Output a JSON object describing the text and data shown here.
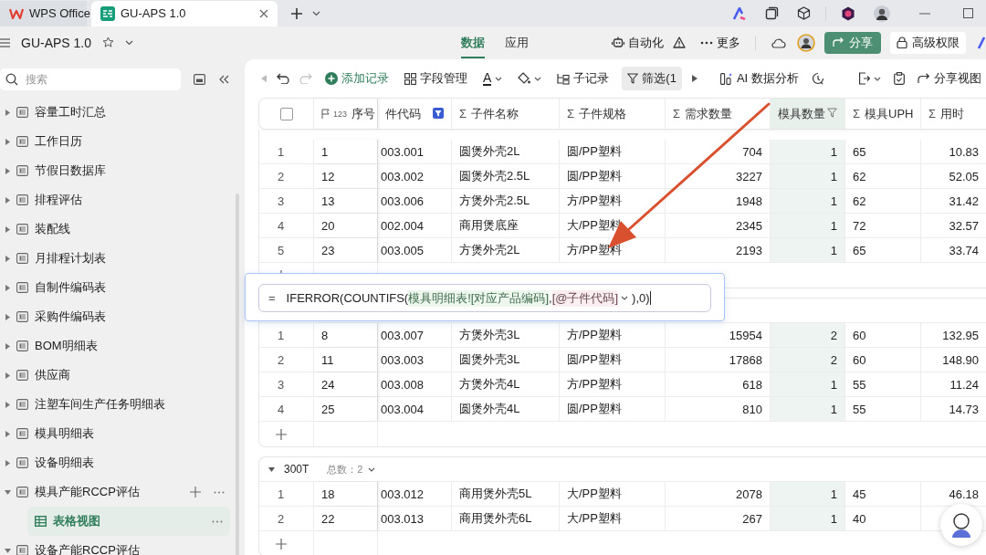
{
  "title_bar": {
    "tabs": [
      {
        "label": "WPS Office",
        "selected": false
      },
      {
        "label": "GU-APS 1.0",
        "selected": true
      }
    ]
  },
  "app_bar": {
    "title": "GU-APS 1.0",
    "tabs": [
      {
        "label": "数据",
        "selected": true
      },
      {
        "label": "应用",
        "selected": false
      }
    ],
    "automation": "自动化",
    "more": "更多",
    "share": "分享",
    "permissions": "高级权限"
  },
  "sidebar": {
    "search": {
      "placeholder": "搜索"
    },
    "items": [
      {
        "label": "容量工时汇总",
        "expanded": false,
        "hovered": false
      },
      {
        "label": "工作日历",
        "expanded": false,
        "hovered": false
      },
      {
        "label": "节假日数据库",
        "expanded": false,
        "hovered": false
      },
      {
        "label": "排程评估",
        "expanded": false,
        "hovered": false
      },
      {
        "label": "装配线",
        "expanded": false,
        "hovered": false
      },
      {
        "label": "月排程计划表",
        "expanded": false,
        "hovered": false
      },
      {
        "label": "自制件编码表",
        "expanded": false,
        "hovered": false
      },
      {
        "label": "采购件编码表",
        "expanded": false,
        "hovered": false
      },
      {
        "label": "BOM明细表",
        "expanded": false,
        "hovered": false
      },
      {
        "label": "供应商",
        "expanded": false,
        "hovered": false
      },
      {
        "label": "注塑车间生产任务明细表",
        "expanded": false,
        "hovered": false
      },
      {
        "label": "模具明细表",
        "expanded": false,
        "hovered": false
      },
      {
        "label": "设备明细表",
        "expanded": false,
        "hovered": false
      },
      {
        "label": "模具产能RCCP评估",
        "expanded": true,
        "hovered": true,
        "children": [
          {
            "label": "表格视图",
            "selected": true
          }
        ]
      },
      {
        "label": "设备产能RCCP评估",
        "expanded": true,
        "hovered": false
      }
    ]
  },
  "toolbar": {
    "redo": {
      "disabled": true
    },
    "add_record": "添加记录",
    "fields": "字段管理",
    "font_glyph": "A",
    "sub_records": "子记录",
    "filter": {
      "label": "筛选(1",
      "active": true
    },
    "ai": "AI 数据分析",
    "share_view": "分享视图"
  },
  "table": {
    "select_all": {
      "checked": false
    },
    "columns": [
      {
        "label": "序号",
        "kind": "index",
        "badge": "123",
        "filtered": false,
        "selected": false
      },
      {
        "label": "件代码",
        "kind": "text",
        "filtered": true,
        "selected": false
      },
      {
        "label": "子件名称",
        "kind": "text",
        "glyph": "Σ",
        "filtered": false,
        "selected": false
      },
      {
        "label": "子件规格",
        "kind": "text",
        "glyph": "Σ",
        "filtered": false,
        "selected": false
      },
      {
        "label": "需求数量",
        "kind": "number",
        "glyph": "Σ",
        "filtered": false,
        "selected": false
      },
      {
        "label": "模具数量",
        "kind": "number",
        "filtered": true,
        "selected": true
      },
      {
        "label": "模具UPH",
        "kind": "text",
        "glyph": "Σ",
        "filtered": false,
        "selected": false
      },
      {
        "label": "用时",
        "kind": "number",
        "glyph": "Σ",
        "filtered": false,
        "selected": false
      }
    ],
    "groups": [
      {
        "expanded": true,
        "rows": [
          {
            "no": "1",
            "cells": [
              "1",
              "003.001",
              "圆煲外壳2L",
              "圆/PP塑料",
              "704",
              "1",
              "65",
              "10.83"
            ]
          },
          {
            "no": "2",
            "cells": [
              "12",
              "003.002",
              "圆煲外壳2.5L",
              "圆/PP塑料",
              "3227",
              "1",
              "62",
              "52.05"
            ]
          },
          {
            "no": "3",
            "cells": [
              "13",
              "003.006",
              "方煲外壳2.5L",
              "方/PP塑料",
              "1948",
              "1",
              "62",
              "31.42"
            ]
          },
          {
            "no": "4",
            "cells": [
              "20",
              "002.004",
              "商用煲底座",
              "大/PP塑料",
              "2345",
              "1",
              "72",
              "32.57"
            ]
          },
          {
            "no": "5",
            "cells": [
              "23",
              "003.005",
              "方煲外壳2L",
              "方/PP塑料",
              "2193",
              "1",
              "65",
              "33.74"
            ]
          }
        ]
      },
      {
        "expanded": true,
        "rows": [
          {
            "no": "1",
            "cells": [
              "8",
              "003.007",
              "方煲外壳3L",
              "方/PP塑料",
              "15954",
              "2",
              "60",
              "132.95"
            ]
          },
          {
            "no": "2",
            "cells": [
              "11",
              "003.003",
              "圆煲外壳3L",
              "圆/PP塑料",
              "17868",
              "2",
              "60",
              "148.90"
            ]
          },
          {
            "no": "3",
            "cells": [
              "24",
              "003.008",
              "方煲外壳4L",
              "方/PP塑料",
              "618",
              "1",
              "55",
              "11.24"
            ]
          },
          {
            "no": "4",
            "cells": [
              "25",
              "003.004",
              "圆煲外壳4L",
              "圆/PP塑料",
              "810",
              "1",
              "55",
              "14.73"
            ]
          }
        ]
      },
      {
        "title": "300T",
        "count": "总数：2",
        "expanded": true,
        "rows": [
          {
            "no": "1",
            "cells": [
              "18",
              "003.012",
              "商用煲外壳5L",
              "大/PP塑料",
              "2078",
              "1",
              "45",
              "46.18"
            ]
          },
          {
            "no": "2",
            "cells": [
              "22",
              "003.013",
              "商用煲外壳6L",
              "大/PP塑料",
              "267",
              "1",
              "40"
            ]
          }
        ]
      }
    ]
  },
  "formula": {
    "prefix": "=",
    "parts": [
      {
        "text": "IFERROR(COUNTIFS(",
        "kind": "plain"
      },
      {
        "text": "模具明细表![对应产品编码]",
        "kind": "table_ref"
      },
      {
        "text": ",",
        "kind": "plain"
      },
      {
        "text": "[@子件代码]",
        "kind": "field_ref"
      },
      {
        "text": "),0)",
        "kind": "plain"
      }
    ]
  }
}
